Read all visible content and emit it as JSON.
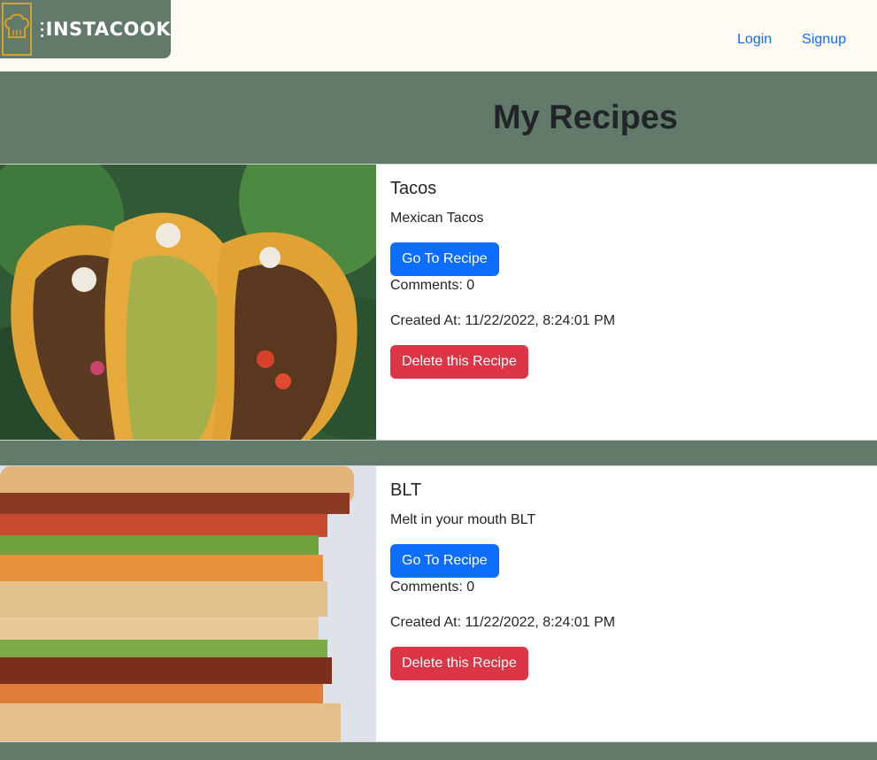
{
  "brand": {
    "name": "INSTACOOK",
    "accent": "#d4a22a",
    "header_green": "#627a69"
  },
  "nav": {
    "login": "Login",
    "signup": "Signup"
  },
  "page": {
    "title": "My Recipes"
  },
  "recipes": [
    {
      "title": "Tacos",
      "description": "Mexican Tacos",
      "go_label": "Go To Recipe",
      "comments": "Comments: 0",
      "created": "Created At: 11/22/2022, 8:24:01 PM",
      "delete_label": "Delete this Recipe"
    },
    {
      "title": "BLT",
      "description": "Melt in your mouth BLT",
      "go_label": "Go To Recipe",
      "comments": "Comments: 0",
      "created": "Created At: 11/22/2022, 8:24:01 PM",
      "delete_label": "Delete this Recipe"
    }
  ],
  "colors": {
    "primary": "#0d6efd",
    "danger": "#dc3545"
  }
}
